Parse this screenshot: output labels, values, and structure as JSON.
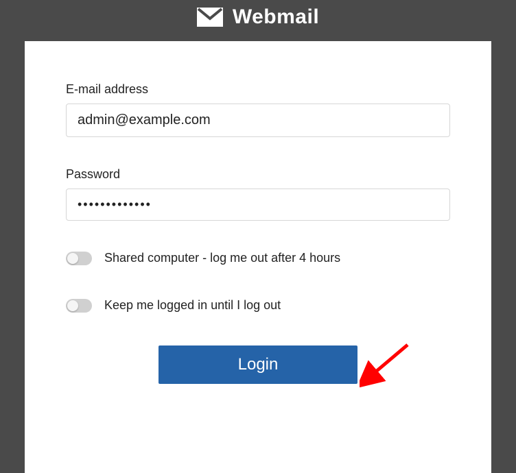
{
  "header": {
    "title": "Webmail"
  },
  "form": {
    "email": {
      "label": "E-mail address",
      "value": "admin@example.com"
    },
    "password": {
      "label": "Password",
      "value": "•••••••••••••"
    },
    "options": {
      "shared_computer": {
        "label": "Shared computer - log me out after 4 hours",
        "checked": false
      },
      "keep_logged_in": {
        "label": "Keep me logged in until I log out",
        "checked": false
      }
    },
    "login_button": "Login"
  }
}
